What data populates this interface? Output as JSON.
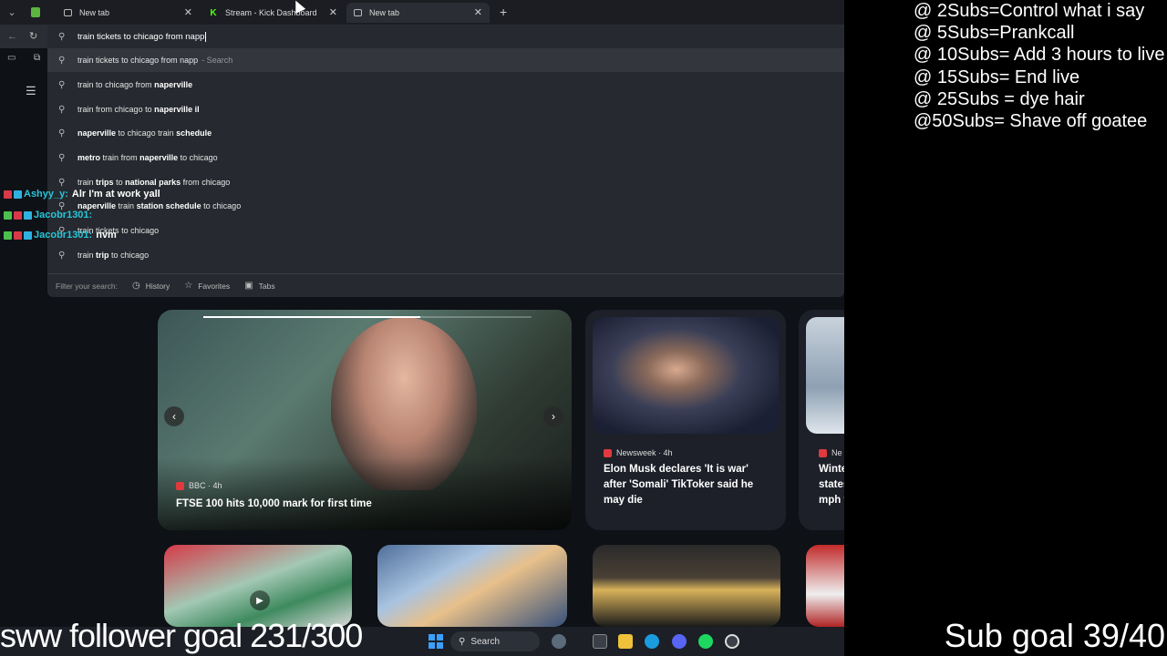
{
  "browser": {
    "tabs": [
      {
        "label": "New tab",
        "favicon": "page-icon",
        "active": false
      },
      {
        "label": "Stream - Kick Dashboard",
        "favicon": "kick-icon",
        "active": false
      },
      {
        "label": "New tab",
        "favicon": "page-icon",
        "active": true
      }
    ],
    "omnibox": {
      "value": "train tickets to chicago from napp",
      "suggestions": [
        {
          "text": "train tickets to chicago from napp",
          "hint": "- Search"
        },
        {
          "text": "train to chicago from naperville"
        },
        {
          "text": "train from chicago to naperville il"
        },
        {
          "text": "naperville to chicago train schedule"
        },
        {
          "text": "metro train from naperville to chicago"
        },
        {
          "text": "train trips to national parks from chicago"
        },
        {
          "text": "naperville train station schedule to chicago"
        },
        {
          "text": "train tickets to chicago"
        },
        {
          "text": "train trip to chicago"
        }
      ],
      "filter": {
        "label": "Filter your search:",
        "history": "History",
        "favorites": "Favorites",
        "tabs": "Tabs"
      }
    },
    "feed": {
      "main": {
        "source": "BBC · 4h",
        "headline": "FTSE 100 hits 10,000 mark for first time"
      },
      "side": {
        "source": "Newsweek · 4h",
        "headline": "Elon Musk declares 'It is war' after 'Somali' TikToker said he may die"
      },
      "edge": {
        "source": "Ne",
        "headline_lines": [
          "Winte",
          "states",
          "mph v"
        ]
      }
    }
  },
  "chat": [
    {
      "user": "Ashyy_y:",
      "message": "Alr I'm at work yall"
    },
    {
      "user": "Jacobr1301:",
      "message": ""
    },
    {
      "user": "Jacobr1301:",
      "message": "nvm"
    }
  ],
  "taskbar": {
    "search_label": "Search"
  },
  "overlay": {
    "follower_goal": "sww follower goal 231/300",
    "sub_goal": "Sub goal 39/40",
    "rules": [
      "@ 2Subs=Control what i say",
      "@ 5Subs=Prankcall",
      "@ 10Subs= Add 3 hours to live",
      "@ 15Subs= End live",
      "@ 25Subs = dye hair",
      "@50Subs=  Shave off goatee"
    ]
  },
  "colors": {
    "chat_user": "#25c7d9",
    "kick_green": "#53fc18",
    "news_red": "#e03a3e"
  }
}
